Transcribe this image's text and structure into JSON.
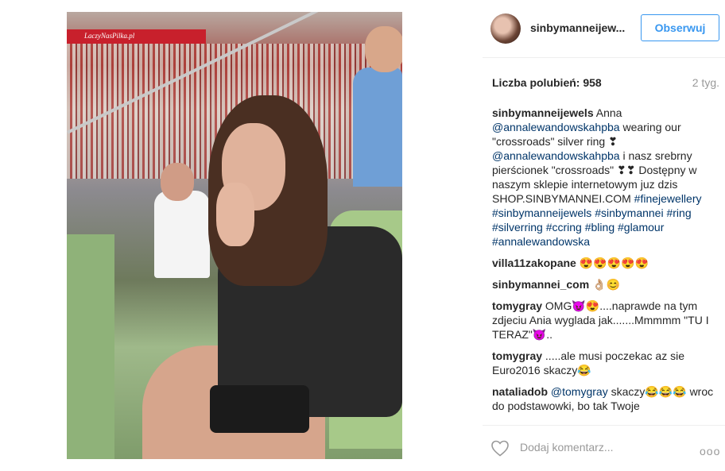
{
  "post": {
    "username": "sinbymanneijew...",
    "follow_label": "Obserwuj",
    "likes_label": "Liczba polubień: 958",
    "time": "2 tyg.",
    "photo_banner": "LaczyNasPilka.pl",
    "add_comment_placeholder": "Dodaj komentarz...",
    "more_label": "ooo"
  },
  "caption": {
    "user": "sinbymanneijewels",
    "t1": " Anna ",
    "m1": "@annalewandowskahpba",
    "t2": " wearing our \"crossroads\" silver ring ❣ ",
    "m2": "@annalewandowskahpba",
    "t3": " i nasz srebrny pierścionek \"crossroads\" ❣❣ Dostępny w naszym sklepie internetowym juz dzis SHOP.SINBYMANNEI.COM ",
    "h1": "#finejewellery",
    "h2": "#sinbymanneijewels",
    "h3": "#sinbymannei",
    "h4": "#ring",
    "h5": "#silverring",
    "h6": "#ccring",
    "h7": "#bling",
    "h8": "#glamour",
    "h9": "#annalewandowska"
  },
  "comments": [
    {
      "user": "villa11zakopane",
      "text": " 😍😍😍😍😍"
    },
    {
      "user": "sinbymannei_com",
      "text": " 👌🏼😊"
    },
    {
      "user": "tomygray",
      "text": " OMG😈😍....naprawde na tym zdjeciu Ania wyglada jak.......Mmmmm \"TU I TERAZ\"😈.."
    },
    {
      "user": "tomygray",
      "text": " .....ale musi poczekac az sie Euro2016 skaczy😂"
    },
    {
      "user": "nataliadob",
      "mention": "@tomygray",
      "text": " skaczy😂😂😂 wroc do podstawowki, bo tak Twoje"
    }
  ]
}
